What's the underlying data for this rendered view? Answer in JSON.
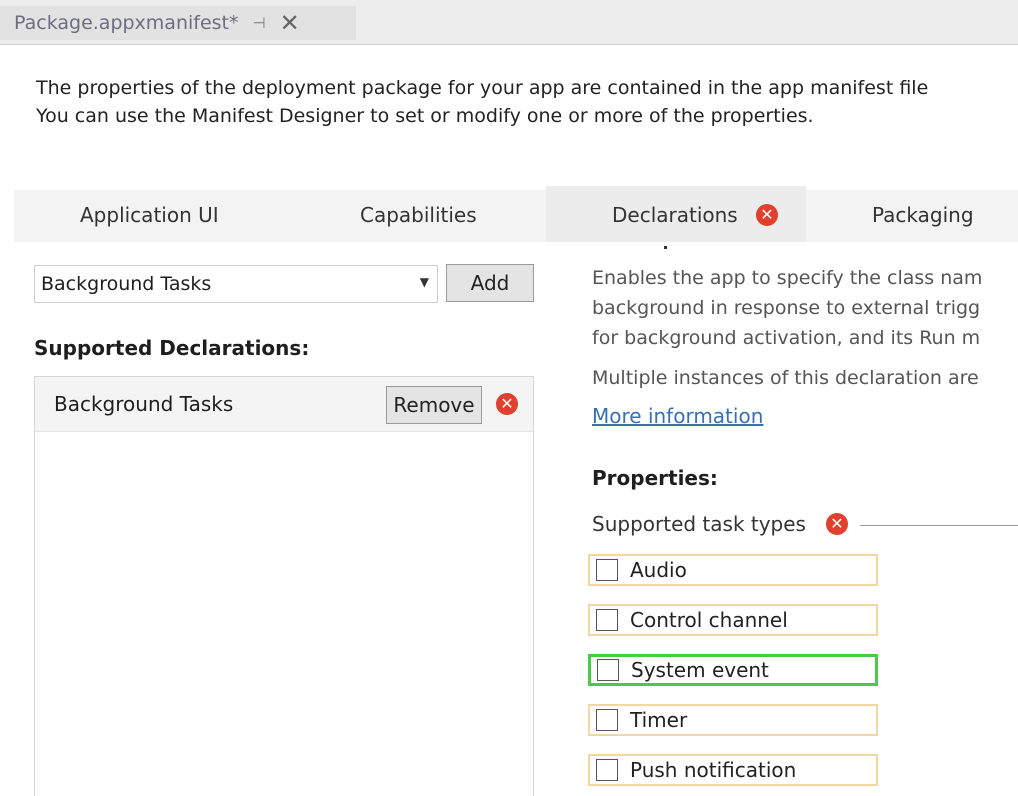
{
  "document_tab": {
    "title": "Package.appxmanifest*",
    "pin_icon": "pin-icon",
    "close_icon": "close-icon",
    "close_glyph": "✕",
    "pin_glyph": "⊣"
  },
  "intro": {
    "line1": "The properties of the deployment package for your app are contained in the app manifest file",
    "line2": "You can use the Manifest Designer to set or modify one or more of the properties."
  },
  "tabs": [
    {
      "label": "Application UI"
    },
    {
      "label": "Capabilities"
    },
    {
      "label": "Declarations",
      "error": true
    },
    {
      "label": "Packaging"
    }
  ],
  "left_panel": {
    "available_declaration": "Background Tasks",
    "add_label": "Add",
    "supported_heading": "Supported Declarations:",
    "supported_items": [
      {
        "label": "Background Tasks",
        "remove_label": "Remove"
      }
    ]
  },
  "right_panel": {
    "description_lines": [
      "Enables the app to specify the class nam",
      "background in response to external trigg",
      "for background activation, and its Run m",
      "Multiple instances of this declaration are"
    ],
    "more_info": "More information",
    "properties_heading": "Properties:",
    "supported_task_types_label": "Supported task types",
    "task_types": [
      {
        "label": "Audio",
        "checked": false
      },
      {
        "label": "Control channel",
        "checked": false
      },
      {
        "label": "System event",
        "checked": false,
        "highlighted": true
      },
      {
        "label": "Timer",
        "checked": false
      },
      {
        "label": "Push notification",
        "checked": false
      }
    ]
  },
  "colors": {
    "error": "#e0402d",
    "link": "#3b6fb4",
    "highlight_border": "#4bc94b",
    "warning_border": "#f1d8a2"
  },
  "error_glyph": "✕"
}
